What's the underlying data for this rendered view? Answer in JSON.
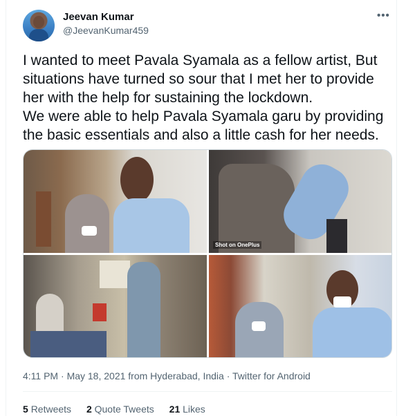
{
  "author": {
    "display_name": "Jeevan Kumar",
    "handle": "@JeevanKumar459"
  },
  "menu": {
    "more_icon": "•••"
  },
  "tweet": {
    "text": "I wanted to meet Pavala Syamala as a fellow artist, But situations have turned so sour that I met her to provide her with the help for sustaining the lockdown.\nWe were able to help Pavala Syamala garu by providing the basic essentials and also a little cash for her needs."
  },
  "media": {
    "watermark": "Shot on OnePlus"
  },
  "meta": {
    "time": "4:11 PM",
    "sep1": " · ",
    "date": "May 18, 2021",
    "location": " from Hyderabad, India",
    "sep2": " · ",
    "source": "Twitter for Android"
  },
  "stats": {
    "retweets_count": "5",
    "retweets_label": "Retweets",
    "quotes_count": "2",
    "quotes_label": "Quote Tweets",
    "likes_count": "21",
    "likes_label": "Likes"
  }
}
